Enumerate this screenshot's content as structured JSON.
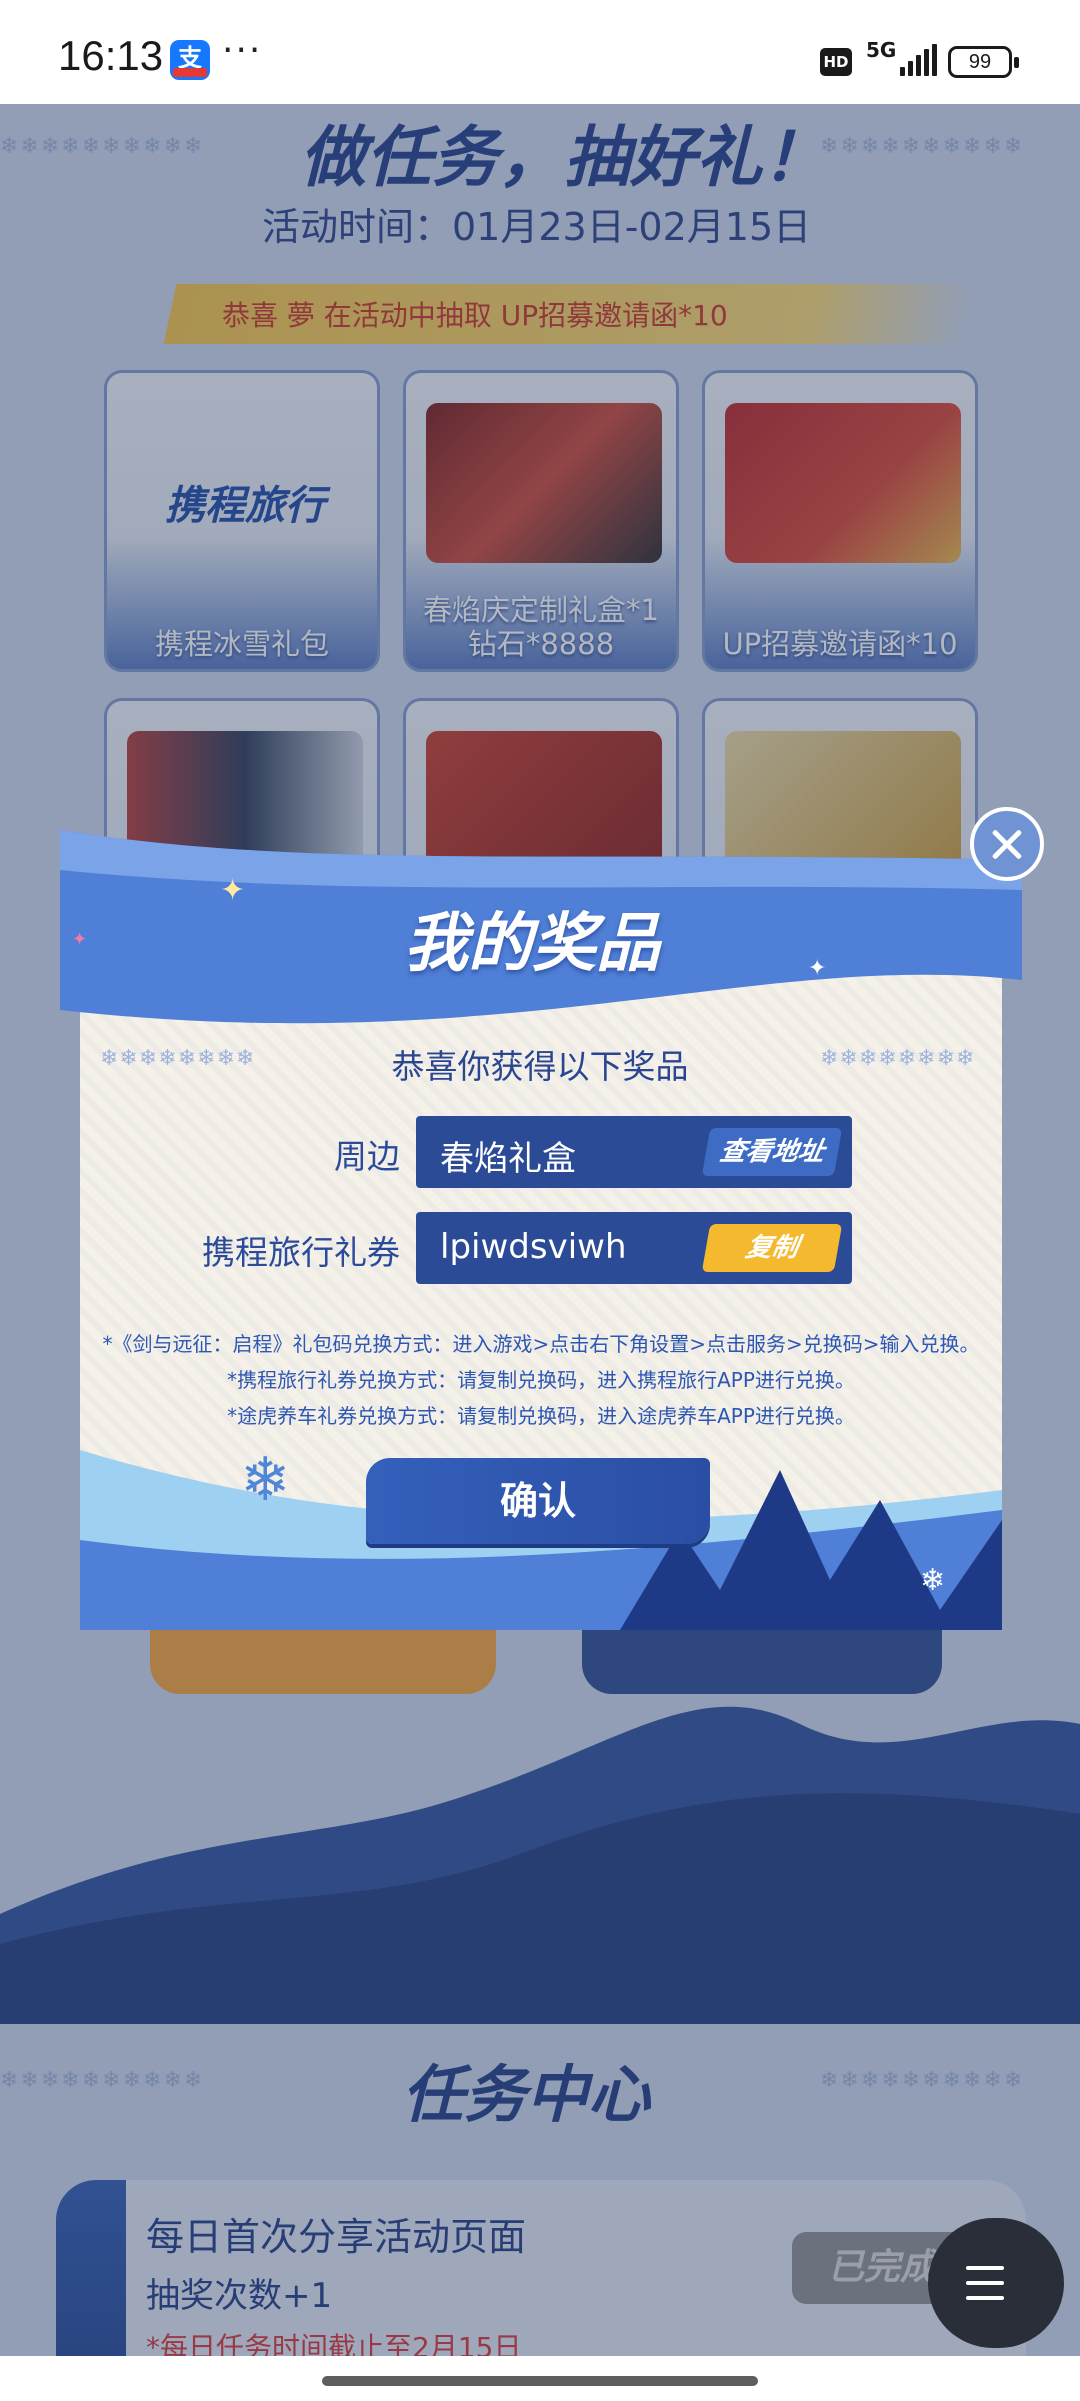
{
  "status_bar": {
    "time": "16:13",
    "app_icon": "alipay-icon",
    "more": "···",
    "hd": "HD",
    "network": "5G",
    "battery": "99"
  },
  "background_page": {
    "hero_title": "做任务，抽好礼！",
    "activity_time": "活动时间：01月23日-02月15日",
    "congrats_banner": "恭喜 夢 在活动中抽取 UP招募邀请函*10",
    "prize_cards": [
      {
        "logo": "携程旅行",
        "label": "携程冰雪礼包"
      },
      {
        "label": "春焰庆定制礼盒*1\n钻石*8888"
      },
      {
        "label": "UP招募邀请函*10"
      }
    ],
    "task_center_title": "任务中心",
    "task": {
      "name": "每日首次分享活动页面",
      "reward": "抽奖次数+1",
      "note": "*每日任务时间截止至2月15日",
      "status_button": "已完成"
    }
  },
  "modal": {
    "title": "我的奖品",
    "subtitle": "恭喜你获得以下奖品",
    "rows": [
      {
        "label": "周边",
        "value": "春焰礼盒",
        "button": "查看地址"
      },
      {
        "label": "携程旅行礼券",
        "value": "lpiwdsviwh",
        "button": "复制"
      }
    ],
    "notes": [
      "*《剑与远征：启程》礼包码兑换方式：进入游戏>点击右下角设置>点击服务>兑换码>输入兑换。",
      "*携程旅行礼券兑换方式：请复制兑换码，进入携程旅行APP进行兑换。",
      "*途虎养车礼券兑换方式：请复制兑换码，进入途虎养车APP进行兑换。"
    ],
    "confirm_button": "确认"
  },
  "colors": {
    "primary_blue": "#2b4b97",
    "accent_yellow": "#f4b92e",
    "title_blue": "#1e3c8c",
    "note_red": "#d6353a"
  }
}
